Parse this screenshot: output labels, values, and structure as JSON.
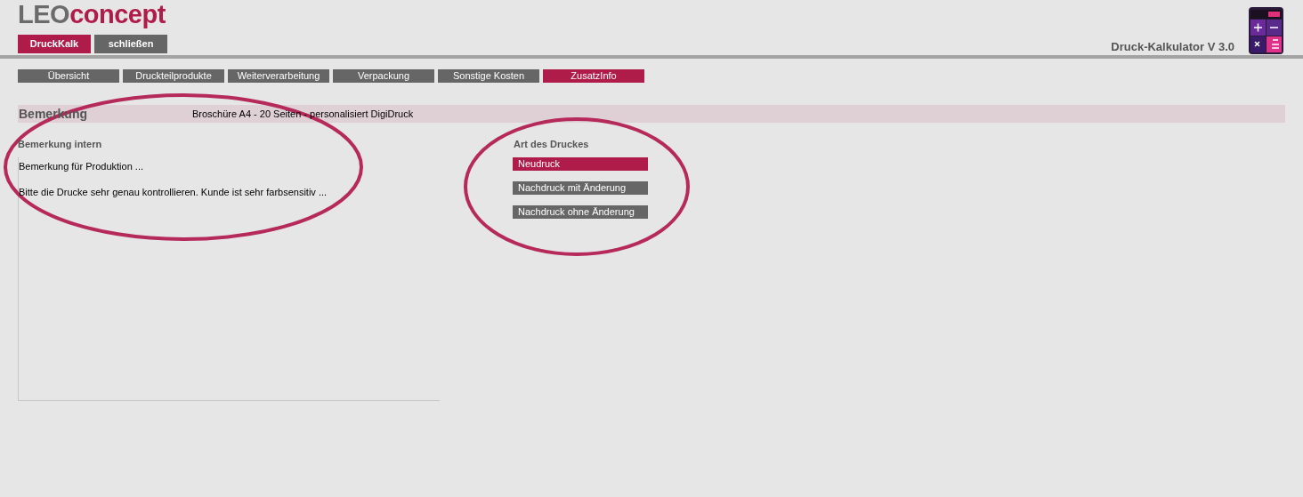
{
  "logo": {
    "first": "LEO",
    "second": "concept"
  },
  "header_buttons": [
    {
      "label": "DruckKalk",
      "selected": true
    },
    {
      "label": "schließen",
      "selected": false
    }
  ],
  "app_title": "Druck-Kalkulator V 3.0",
  "tabs": [
    {
      "label": "Übersicht",
      "selected": false
    },
    {
      "label": "Druckteilprodukte",
      "selected": false
    },
    {
      "label": "Weiterverarbeitung",
      "selected": false
    },
    {
      "label": "Verpackung",
      "selected": false
    },
    {
      "label": "Sonstige Kosten",
      "selected": false
    },
    {
      "label": "ZusatzInfo",
      "selected": true
    }
  ],
  "section": {
    "title": "Bemerkung",
    "subtitle": "Broschüre A4 - 20 Seiten - personalisiert DigiDruck"
  },
  "remark": {
    "label": "Bemerkung intern",
    "lines": [
      "Bemerkung für Produktion ...",
      "Bitte die Drucke sehr genau kontrollieren. Kunde ist sehr farbsensitiv ..."
    ]
  },
  "print_type": {
    "label": "Art des Druckes",
    "options": [
      {
        "label": "Neudruck",
        "selected": true
      },
      {
        "label": "Nachdruck mit Änderung",
        "selected": false
      },
      {
        "label": "Nachdruck ohne Änderung",
        "selected": false
      }
    ]
  }
}
